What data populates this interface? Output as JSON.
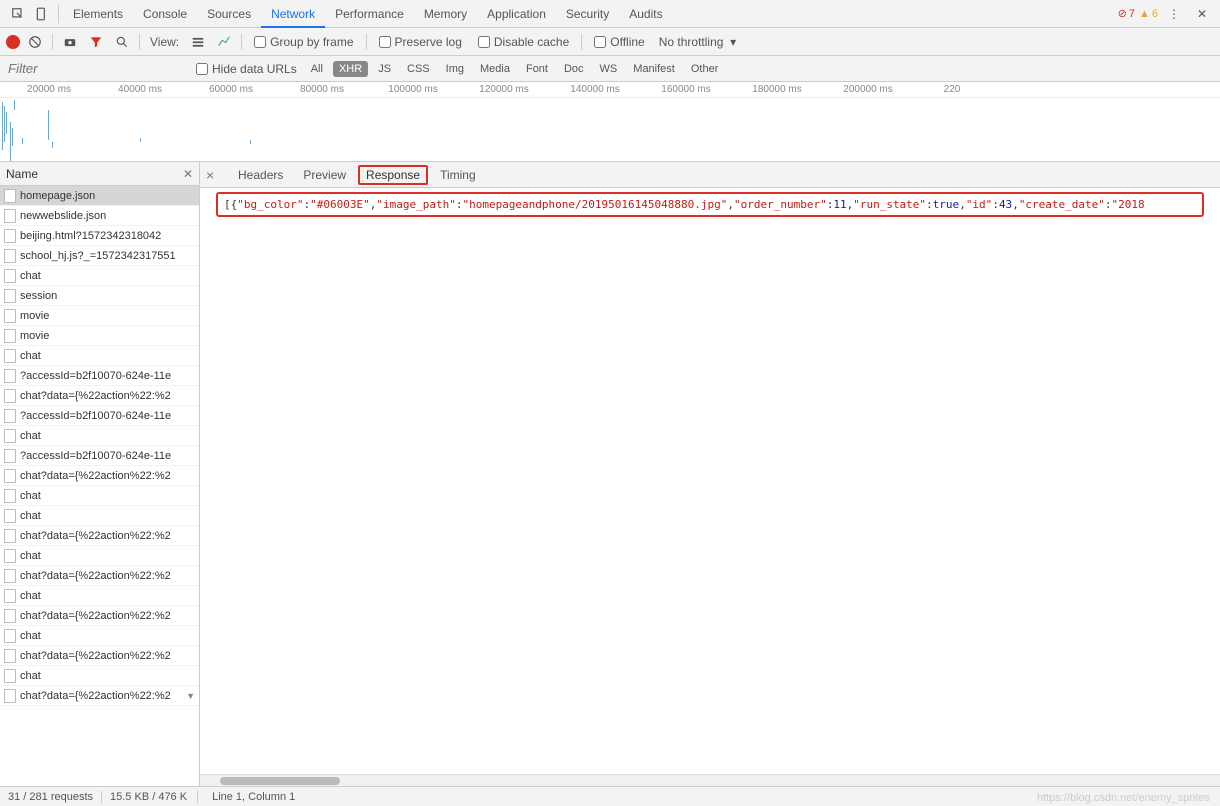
{
  "topTabs": [
    "Elements",
    "Console",
    "Sources",
    "Network",
    "Performance",
    "Memory",
    "Application",
    "Security",
    "Audits"
  ],
  "activeTopTab": "Network",
  "errors": "7",
  "warnings": "6",
  "toolbar": {
    "view_label": "View:",
    "group_by_frame": "Group by frame",
    "preserve_log": "Preserve log",
    "disable_cache": "Disable cache",
    "offline": "Offline",
    "throttling": "No throttling"
  },
  "filter": {
    "placeholder": "Filter",
    "hide_data_urls": "Hide data URLs",
    "chips": [
      "All",
      "XHR",
      "JS",
      "CSS",
      "Img",
      "Media",
      "Font",
      "Doc",
      "WS",
      "Manifest",
      "Other"
    ],
    "active_chip": "XHR"
  },
  "timeline": {
    "ticks": [
      {
        "label": "20000 ms",
        "pct": 7
      },
      {
        "label": "40000 ms",
        "pct": 20
      },
      {
        "label": "60000 ms",
        "pct": 33
      },
      {
        "label": "80000 ms",
        "pct": 46
      },
      {
        "label": "100000 ms",
        "pct": 59
      },
      {
        "label": "120000 ms",
        "pct": 72
      },
      {
        "label": "140000 ms",
        "pct": 85
      },
      {
        "label": "160000 ms",
        "pct": 98
      },
      {
        "label": "180000 ms",
        "pct": 111
      },
      {
        "label": "200000 ms",
        "pct": 124
      },
      {
        "label": "220",
        "pct": 136
      }
    ]
  },
  "sidebar": {
    "title": "Name",
    "requests": [
      "homepage.json",
      "newwebslide.json",
      "beijing.html?1572342318042",
      "school_hj.js?_=1572342317551",
      "chat",
      "session",
      "movie",
      "movie",
      "chat",
      "?accessId=b2f10070-624e-11e",
      "chat?data={%22action%22:%2",
      "?accessId=b2f10070-624e-11e",
      "chat",
      "?accessId=b2f10070-624e-11e",
      "chat?data={%22action%22:%2",
      "chat",
      "chat",
      "chat?data={%22action%22:%2",
      "chat",
      "chat?data={%22action%22:%2",
      "chat",
      "chat?data={%22action%22:%2",
      "chat",
      "chat?data={%22action%22:%2",
      "chat",
      "chat?data={%22action%22:%2"
    ],
    "selected": 0,
    "last_has_caret": true
  },
  "detail": {
    "tabs": [
      "Headers",
      "Preview",
      "Response",
      "Timing"
    ],
    "active": "Response",
    "response_tokens": [
      {
        "t": "[{",
        "c": ""
      },
      {
        "t": "\"bg_color\"",
        "c": "str"
      },
      {
        "t": ":",
        "c": ""
      },
      {
        "t": "\"#06003E\"",
        "c": "str"
      },
      {
        "t": ",",
        "c": ""
      },
      {
        "t": "\"image_path\"",
        "c": "str"
      },
      {
        "t": ":",
        "c": ""
      },
      {
        "t": "\"homepageandphone/20195016145048880.jpg\"",
        "c": "str"
      },
      {
        "t": ",",
        "c": ""
      },
      {
        "t": "\"order_number\"",
        "c": "str"
      },
      {
        "t": ":",
        "c": ""
      },
      {
        "t": "11",
        "c": "num"
      },
      {
        "t": ",",
        "c": ""
      },
      {
        "t": "\"run_state\"",
        "c": "str"
      },
      {
        "t": ":",
        "c": ""
      },
      {
        "t": "true",
        "c": "bool"
      },
      {
        "t": ",",
        "c": ""
      },
      {
        "t": "\"id\"",
        "c": "str"
      },
      {
        "t": ":",
        "c": ""
      },
      {
        "t": "43",
        "c": "num"
      },
      {
        "t": ",",
        "c": ""
      },
      {
        "t": "\"create_date\"",
        "c": "str"
      },
      {
        "t": ":",
        "c": ""
      },
      {
        "t": "\"2018",
        "c": "str"
      }
    ]
  },
  "status": {
    "requests": "31 / 281 requests",
    "transfer": "15.5 KB / 476 K",
    "cursor": "Line 1, Column 1"
  },
  "watermark": "https://blog.csdn.net/enemy_sprites"
}
